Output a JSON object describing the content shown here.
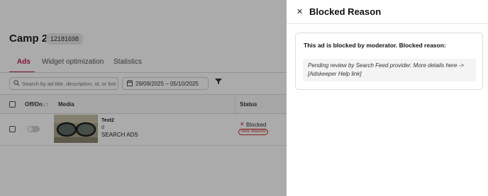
{
  "campaign": {
    "title": "Camp 2",
    "id": "12181698"
  },
  "tabs": [
    {
      "label": "Ads",
      "active": true
    },
    {
      "label": "Widget optimization",
      "active": false
    },
    {
      "label": "Statistics",
      "active": false
    }
  ],
  "search": {
    "placeholder": "Search by ad title, description, id, or link"
  },
  "date_range": {
    "value": "29/09/2025 – 05/10/2025"
  },
  "table": {
    "headers": {
      "off_on": "Off/On",
      "sort_icon": "↓↑",
      "media": "Media",
      "status": "Status"
    },
    "rows": [
      {
        "title": "Text2",
        "description": "d",
        "category": "SEARCH ADS",
        "status": "Blocked",
        "view_reasons": "View reasons",
        "enabled": false
      }
    ]
  },
  "panel": {
    "title": "Blocked Reason",
    "card_title": "This ad is blocked by moderator. Blocked reason:",
    "reason": "Pending review by Search Feed provider. More details here -> [Adskeeper Help link]"
  },
  "colors": {
    "accent": "#c2185b",
    "blocked": "#c62828",
    "overlay": "rgba(0,0,0,0.33)"
  },
  "icons": [
    "search-icon",
    "calendar-icon",
    "filter-icon",
    "close-icon",
    "sort-icon"
  ]
}
